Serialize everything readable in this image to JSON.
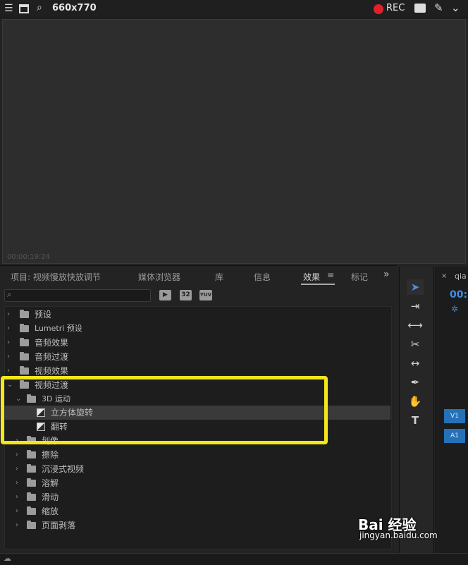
{
  "capture_bar": {
    "size_label": "660x770",
    "rec_label": "REC"
  },
  "monitor": {
    "timecode": "00:00:19:24"
  },
  "panel": {
    "tabs": [
      {
        "label": "项目: 视频慢放快放调节"
      },
      {
        "label": "媒体浏览器"
      },
      {
        "label": "库"
      },
      {
        "label": "信息"
      },
      {
        "label": "效果"
      },
      {
        "label": "标记"
      }
    ],
    "badges": [
      "32",
      "YUV"
    ],
    "tree": [
      {
        "label": "预设",
        "level": 0,
        "expanded": false
      },
      {
        "label": "Lumetri 预设",
        "level": 0,
        "expanded": false
      },
      {
        "label": "音频效果",
        "level": 0,
        "expanded": false
      },
      {
        "label": "音频过渡",
        "level": 0,
        "expanded": false
      },
      {
        "label": "视频效果",
        "level": 0,
        "expanded": false
      },
      {
        "label": "视频过渡",
        "level": 0,
        "expanded": true
      },
      {
        "label": "3D 运动",
        "level": 1,
        "expanded": true
      },
      {
        "label": "立方体旋转",
        "level": 2,
        "selected": true
      },
      {
        "label": "翻转",
        "level": 2
      },
      {
        "label": "划像",
        "level": 1,
        "expanded": false
      },
      {
        "label": "擦除",
        "level": 1,
        "expanded": false
      },
      {
        "label": "沉浸式视频",
        "level": 1,
        "expanded": false
      },
      {
        "label": "溶解",
        "level": 1,
        "expanded": false
      },
      {
        "label": "滑动",
        "level": 1,
        "expanded": false
      },
      {
        "label": "缩放",
        "level": 1,
        "expanded": false
      },
      {
        "label": "页面剥落",
        "level": 1,
        "expanded": false
      }
    ]
  },
  "timeline": {
    "tab_label": "qia",
    "timecode": "00:",
    "tracks": [
      "V1",
      "A1"
    ]
  },
  "watermark": {
    "brand": "Bai 经验",
    "url": "jingyan.baidu.com"
  }
}
